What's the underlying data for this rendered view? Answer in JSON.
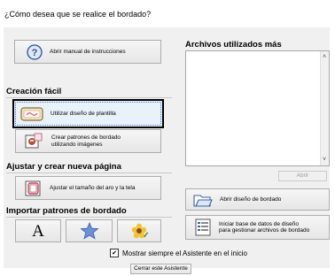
{
  "dialog": {
    "question": "¿Cómo desea que se realice el bordado?"
  },
  "buttons": {
    "manual": "Abrir manual de instrucciones",
    "template": "Utilizar diseño de plantilla",
    "from_image_line1": "Crear patrones de bordado",
    "from_image_line2": "utilizando imágenes",
    "hoop_size": "Ajustar el tamaño del aro y la tela",
    "open_design": "Abrir diseño de bordado",
    "database_line1": "Iniciar base de datos de diseño",
    "database_line2": "para gestionar archivos de bordado",
    "open": "Abrir",
    "close_wizard": "Cerrar este Asistente"
  },
  "sections": {
    "easy_creation": "Creación fácil",
    "adjust_new_page": "Ajustar y crear nueva página",
    "import_patterns": "Importar patrones de bordado",
    "recent_files": "Archivos utilizados más"
  },
  "import_icons": {
    "text_glyph": "A"
  },
  "checkbox": {
    "label": "Mostrar siempre el Asistente en el inicio",
    "checked": true
  },
  "icons": {
    "help": "question-icon",
    "template": "hoop-template-icon",
    "image": "image-embroidery-icon",
    "hoop": "hoop-size-icon",
    "text": "text-letter-icon",
    "star": "star-pattern-icon",
    "flower": "flower-pattern-icon",
    "folder": "open-folder-icon",
    "database": "database-list-icon"
  },
  "colors": {
    "selected_border": "#000000",
    "focus_border": "#3c7fd8",
    "help_icon": "#2c4f9e"
  }
}
